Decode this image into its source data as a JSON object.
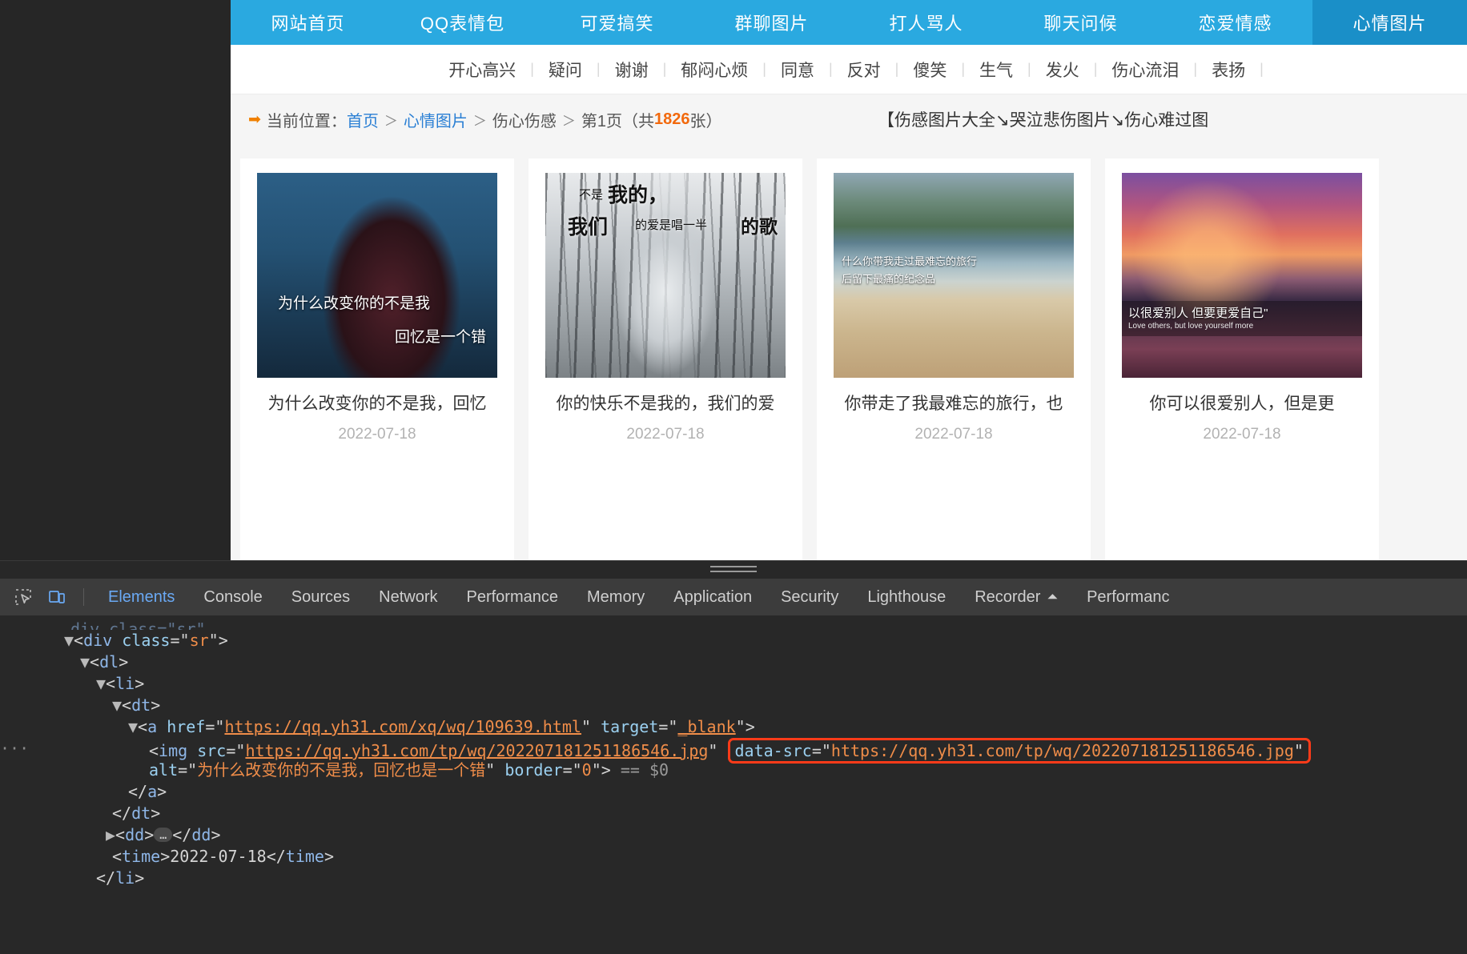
{
  "site": {
    "main_nav": [
      {
        "label": "网站首页",
        "active": false
      },
      {
        "label": "QQ表情包",
        "active": false
      },
      {
        "label": "可爱搞笑",
        "active": false
      },
      {
        "label": "群聊图片",
        "active": false
      },
      {
        "label": "打人骂人",
        "active": false
      },
      {
        "label": "聊天问候",
        "active": false
      },
      {
        "label": "恋爱情感",
        "active": false
      },
      {
        "label": "心情图片",
        "active": true
      }
    ],
    "sub_nav": [
      "开心高兴",
      "疑问",
      "谢谢",
      "郁闷心烦",
      "同意",
      "反对",
      "傻笑",
      "生气",
      "发火",
      "伤心流泪",
      "表扬"
    ],
    "sub_nav_separator": "|",
    "breadcrumb": {
      "arrow_icon": "➡",
      "label": "当前位置：",
      "home_link": "首页",
      "sep": "＞",
      "category_link": "心情图片",
      "subcategory": "伤心伤感",
      "page_prefix": "第1页（共",
      "count": "1826",
      "page_suffix": "张）",
      "page_title": "【伤感图片大全↘哭泣悲伤图片↘伤心难过图"
    },
    "cards": [
      {
        "caption": "为什么改变你的不是我，回忆",
        "date": "2022-07-18",
        "overlay_line1": "为什么改变你的不是我",
        "overlay_line2": "回忆是一个错"
      },
      {
        "caption": "你的快乐不是我的，我们的爱",
        "date": "2022-07-18",
        "overlay_a": "不是",
        "overlay_b": "我的，",
        "overlay_c": "我们",
        "overlay_d": "的爱是唱一半",
        "overlay_e": "的歌"
      },
      {
        "caption": "你带走了我最难忘的旅行，也",
        "date": "2022-07-18",
        "overlay_line1": "什么你带我走过最难忘的旅行",
        "overlay_line2": "后留下最痛的纪念品"
      },
      {
        "caption": "你可以很爱别人，但是更",
        "date": "2022-07-18",
        "overlay_line1": "以很爱别人 但要更爱自己\"",
        "overlay_line2": "Love others, but love yourself more"
      }
    ]
  },
  "devtools": {
    "inspect_icon": "inspect-element-icon",
    "device_icon": "device-toolbar-icon",
    "tabs": [
      {
        "label": "Elements",
        "active": true
      },
      {
        "label": "Console",
        "active": false
      },
      {
        "label": "Sources",
        "active": false
      },
      {
        "label": "Network",
        "active": false
      },
      {
        "label": "Performance",
        "active": false
      },
      {
        "label": "Memory",
        "active": false
      },
      {
        "label": "Application",
        "active": false
      },
      {
        "label": "Security",
        "active": false
      },
      {
        "label": "Lighthouse",
        "active": false
      },
      {
        "label": "Recorder",
        "active": false,
        "glyph": "⏶"
      },
      {
        "label": "Performanc",
        "active": false
      }
    ],
    "dom": {
      "row_partial": "div class=\"sr\"   ...",
      "row_div_sr": {
        "tag": "div",
        "attr": "class",
        "value": "sr"
      },
      "row_dl": "dl",
      "row_li": "li",
      "row_dt": "dt",
      "row_a": {
        "tag": "a",
        "href_name": "href",
        "href_value": "https://qq.yh31.com/xq/wq/109639.html",
        "target_name": "target",
        "target_value": "_blank"
      },
      "row_img": {
        "tag": "img",
        "src_name": "src",
        "src_value": "https://qq.yh31.com/tp/wq/202207181251186546.jpg",
        "datasrc_name": "data-src",
        "datasrc_value": "https://qq.yh31.com/tp/wq/202207181251186546.jpg",
        "selected_marker": "== $0"
      },
      "row_alt": {
        "alt_name": "alt",
        "alt_value": "为什么改变你的不是我，回忆也是一个错",
        "border_name": "border",
        "border_value": "0",
        "selected_marker": "== $0"
      },
      "row_close_a": "</a>",
      "row_close_dt": "</dt>",
      "row_dd_open": "dd",
      "row_dd_dots": "…",
      "row_dd_close": "</dd>",
      "row_time_open": "<time>",
      "row_time_text": "2022-07-18",
      "row_time_close": "</time>",
      "row_close_li": "</li>"
    }
  },
  "colors": {
    "nav_blue": "#2aa9e0",
    "nav_blue_active": "#1a8fc8",
    "link_blue": "#2a7fd4",
    "accent_orange": "#f2690d",
    "devtools_bg": "#282828",
    "devtools_tabbar": "#3c3c3c",
    "highlight_red": "#ff3b19",
    "active_tab_blue": "#6aa9f4"
  }
}
